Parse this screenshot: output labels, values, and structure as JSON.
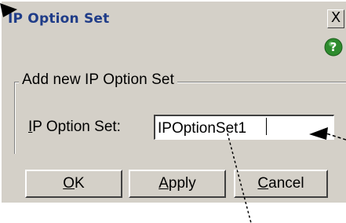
{
  "window": {
    "title": "IP Option Set",
    "close_label": "X"
  },
  "group": {
    "title": "Add new IP Option Set",
    "field_label_mnemonic": "I",
    "field_label_rest": "P Option Set:",
    "field_value": "IPOptionSet1"
  },
  "buttons": {
    "ok_mnemonic": "O",
    "ok_rest": "K",
    "apply_mnemonic": "A",
    "apply_rest": "pply",
    "cancel_mnemonic": "C",
    "cancel_rest": "ancel"
  },
  "icons": {
    "help": "help-icon",
    "close": "close-icon",
    "callout_arrow": "callout-arrow-icon"
  },
  "colors": {
    "dialog_bg": "#d4d0c8",
    "title_text": "#1f3c88",
    "help_green": "#2e8b2e"
  }
}
